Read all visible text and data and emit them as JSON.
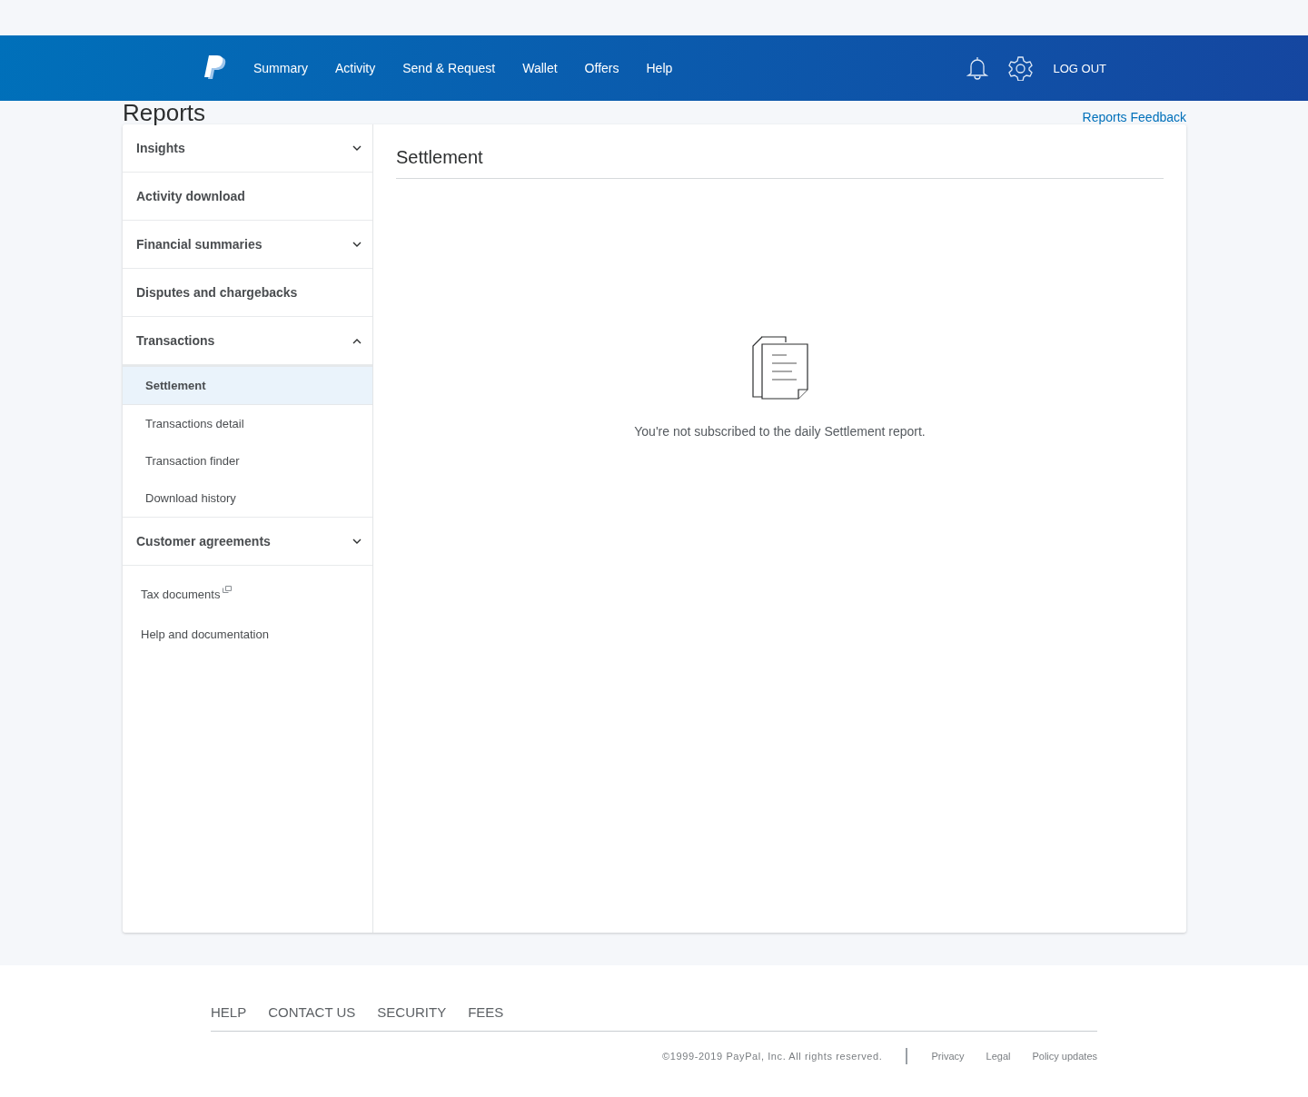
{
  "header": {
    "nav": [
      {
        "label": "Summary"
      },
      {
        "label": "Activity"
      },
      {
        "label": "Send & Request"
      },
      {
        "label": "Wallet"
      },
      {
        "label": "Offers"
      },
      {
        "label": "Help"
      }
    ],
    "logout": "LOG OUT"
  },
  "page": {
    "title": "Reports",
    "feedback": "Reports Feedback"
  },
  "sidebar": {
    "sections": [
      {
        "kind": "group",
        "label": "Insights",
        "expanded": false
      },
      {
        "kind": "link",
        "label": "Activity download"
      },
      {
        "kind": "group",
        "label": "Financial summaries",
        "expanded": false
      },
      {
        "kind": "link",
        "label": "Disputes and chargebacks"
      },
      {
        "kind": "group",
        "label": "Transactions",
        "expanded": true,
        "children": [
          {
            "label": "Settlement",
            "selected": true
          },
          {
            "label": "Transactions detail",
            "selected": false
          },
          {
            "label": "Transaction finder",
            "selected": false
          },
          {
            "label": "Download history",
            "selected": false
          }
        ]
      },
      {
        "kind": "group",
        "label": "Customer agreements",
        "expanded": false
      }
    ],
    "links": [
      {
        "label": "Tax documents",
        "external": true
      },
      {
        "label": "Help and documentation",
        "external": false
      }
    ]
  },
  "content": {
    "title": "Settlement",
    "message": "You're not subscribed to the daily Settlement report."
  },
  "footer": {
    "links": [
      "HELP",
      "CONTACT US",
      "SECURITY",
      "FEES"
    ],
    "copyright": "©1999-2019 PayPal, Inc. All rights reserved.",
    "legal": [
      "Privacy",
      "Legal",
      "Policy updates"
    ]
  }
}
